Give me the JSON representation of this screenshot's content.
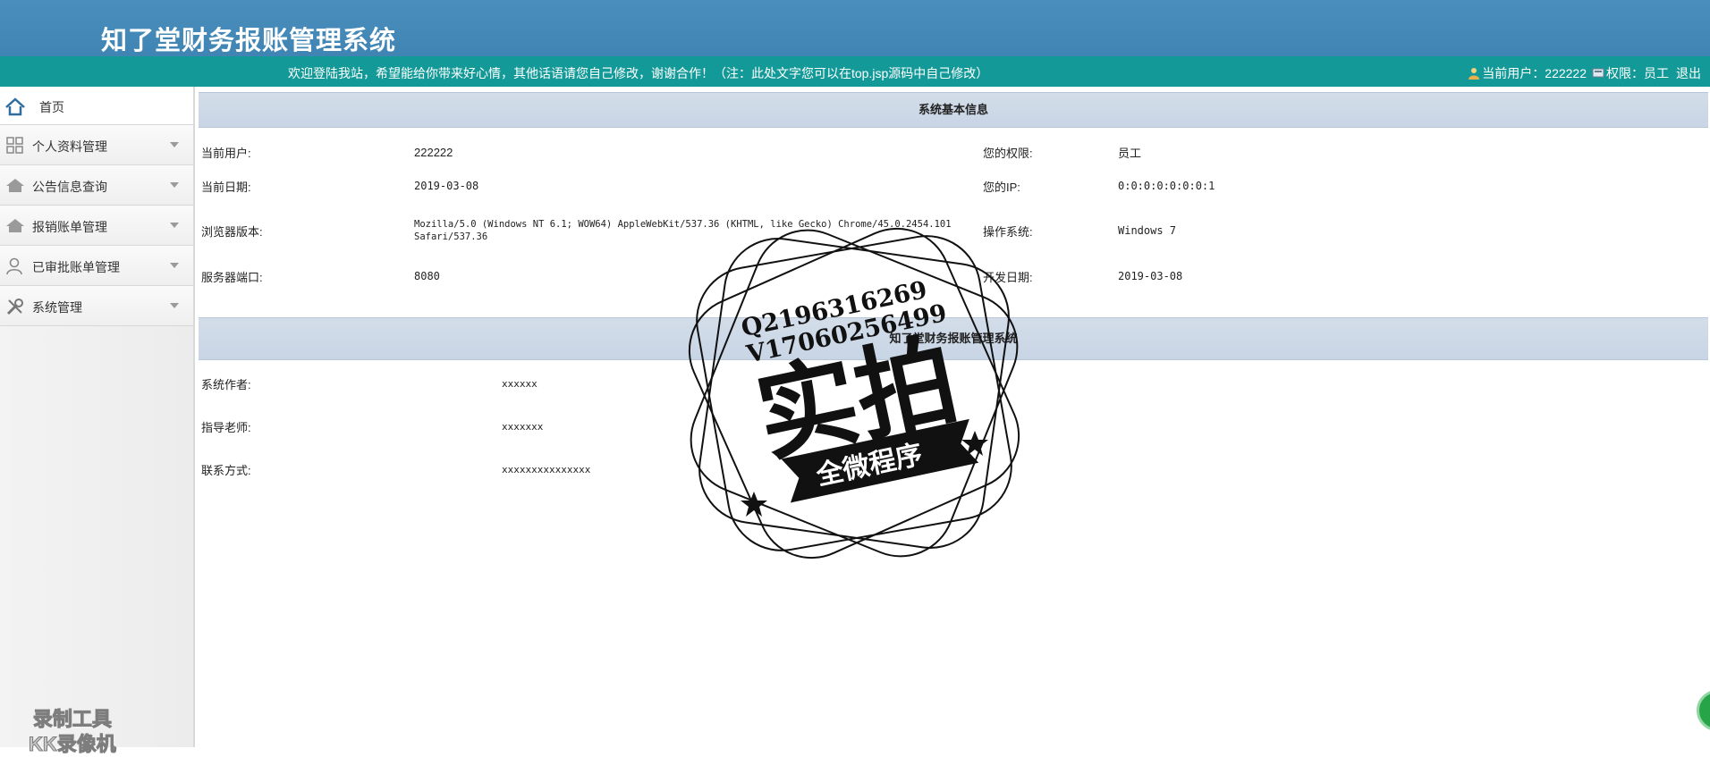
{
  "header": {
    "app_title": "知了堂财务报账管理系统"
  },
  "topbar": {
    "welcome": "欢迎登陆我站，希望能给你带来好心情，其他话语请您自己修改，谢谢合作！（注：此处文字您可以在top.jsp源码中自己修改）",
    "current_user_label": "当前用户：222222",
    "role_label": "权限：员工",
    "logout": "退出"
  },
  "sidebar": {
    "items": [
      {
        "label": "首页",
        "icon": "home-icon"
      },
      {
        "label": "个人资料管理",
        "icon": "grid-icon"
      },
      {
        "label": "公告信息查询",
        "icon": "house-icon"
      },
      {
        "label": "报销账单管理",
        "icon": "house-icon"
      },
      {
        "label": "已审批账单管理",
        "icon": "user-icon"
      },
      {
        "label": "系统管理",
        "icon": "wrench-icon"
      }
    ]
  },
  "system_info": {
    "title": "系统基本信息",
    "current_user_label": "当前用户:",
    "current_user": "222222",
    "role_label": "您的权限:",
    "role": "员工",
    "date_label": "当前日期:",
    "date": "2019-03-08",
    "ip_label": "您的IP:",
    "ip": "0:0:0:0:0:0:0:1",
    "browser_label": "浏览器版本:",
    "browser_line1": "Mozilla/5.0 (Windows NT 6.1; WOW64) AppleWebKit/537.36 (KHTML, like Gecko) Chrome/45.0.2454.101",
    "browser_line2": "Safari/537.36",
    "os_label": "操作系统:",
    "os": "Windows 7",
    "port_label": "服务器端口:",
    "port": "8080",
    "dev_date_label": "开发日期:",
    "dev_date": "2019-03-08"
  },
  "about": {
    "title": "知了堂财务报账管理系统",
    "author_label": "系统作者:",
    "author": "xxxxxx",
    "teacher_label": "指导老师:",
    "teacher": "xxxxxxx",
    "contact_label": "联系方式:",
    "contact": "xxxxxxxxxxxxxxx"
  },
  "watermark": {
    "line1": "Q2196316269",
    "line2": "V17060256499",
    "big": "实拍",
    "ribbon": "全微程序"
  },
  "recorder_badge": {
    "line1": "录制工具",
    "line2": "KK录像机"
  },
  "colors": {
    "header": "#4a8fbc",
    "topbar": "#139a98",
    "section_title": "#ccd8e6"
  }
}
